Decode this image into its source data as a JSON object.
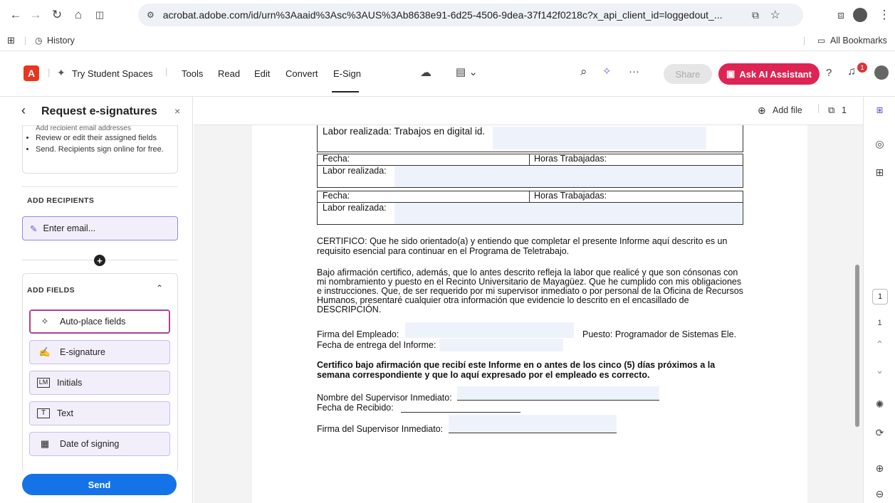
{
  "browser": {
    "url": "acrobat.adobe.com/id/urn%3Aaaid%3Asc%3AUS%3Ab8638e91-6d25-4506-9dea-37f142f0218c?x_api_client_id=loggedout_...",
    "history_label": "History",
    "all_bookmarks_label": "All Bookmarks"
  },
  "app": {
    "try_student_spaces": "Try Student Spaces",
    "menu": [
      "Tools",
      "Read",
      "Edit",
      "Convert",
      "E-Sign"
    ],
    "share_label": "Share",
    "ask_ai_label": "Ask AI Assistant",
    "notification_count": "1"
  },
  "panel": {
    "title": "Request e-signatures",
    "bullets_cut": "Add recipient email addresses",
    "bullets": [
      "Review or edit their assigned fields",
      "Send. Recipients sign online for free."
    ],
    "add_recipients_label": "ADD RECIPIENTS",
    "email_placeholder": "Enter email...",
    "add_fields_label": "ADD FIELDS",
    "fields": [
      "Auto-place fields",
      "E-signature",
      "Initials",
      "Text",
      "Date of signing"
    ],
    "send_label": "Send"
  },
  "doc_toolbar": {
    "add_file_label": "Add file",
    "page_count": "1"
  },
  "document": {
    "labor1": "Labor realizada: Trabajos en digital id.",
    "fecha": "Fecha:",
    "horas": "Horas Trabajadas:",
    "labor": "Labor realizada:",
    "certifico_1": "CERTIFICO: Que he sido orientado(a) y entiendo que completar el presente Informe aquí descrito es un",
    "certifico_2": "requisito esencial para continuar en el Programa de Teletrabajo.",
    "bajo_1": "Bajo afirmación certifico, además, que lo antes descrito refleja la labor que realicé y que son cónsonas con",
    "bajo_2": "mi nombramiento y puesto en el Recinto Universitario de Mayagüez. Que he cumplido con mis obligaciones",
    "bajo_3": "e instrucciones. Que, de ser requerido por mi supervisor inmediato o por personal de la Oficina de Recursos",
    "bajo_4": "Humanos, presentaré cualquier otra información que evidencie lo descrito en el encasillado de",
    "bajo_5": "DESCRIPCIÓN.",
    "firma_empleado": "Firma del Empleado:",
    "puesto": "Puesto: Programador de Sistemas Ele.",
    "fecha_entrega": "Fecha de entrega del Informe:",
    "cert_bold_1": "Certifico bajo afirmación que recibí este Informe en o antes de los cinco (5) días próximos a la",
    "cert_bold_2": "semana correspondiente y que lo aquí expresado por el empleado es correcto.",
    "nombre_supervisor": "Nombre del Supervisor Inmediato:",
    "fecha_recibido": "Fecha de Recibido:",
    "firma_supervisor": "Firma del Supervisor Inmediato:"
  },
  "right_rail": {
    "page_box": "1",
    "page_total": "1"
  }
}
